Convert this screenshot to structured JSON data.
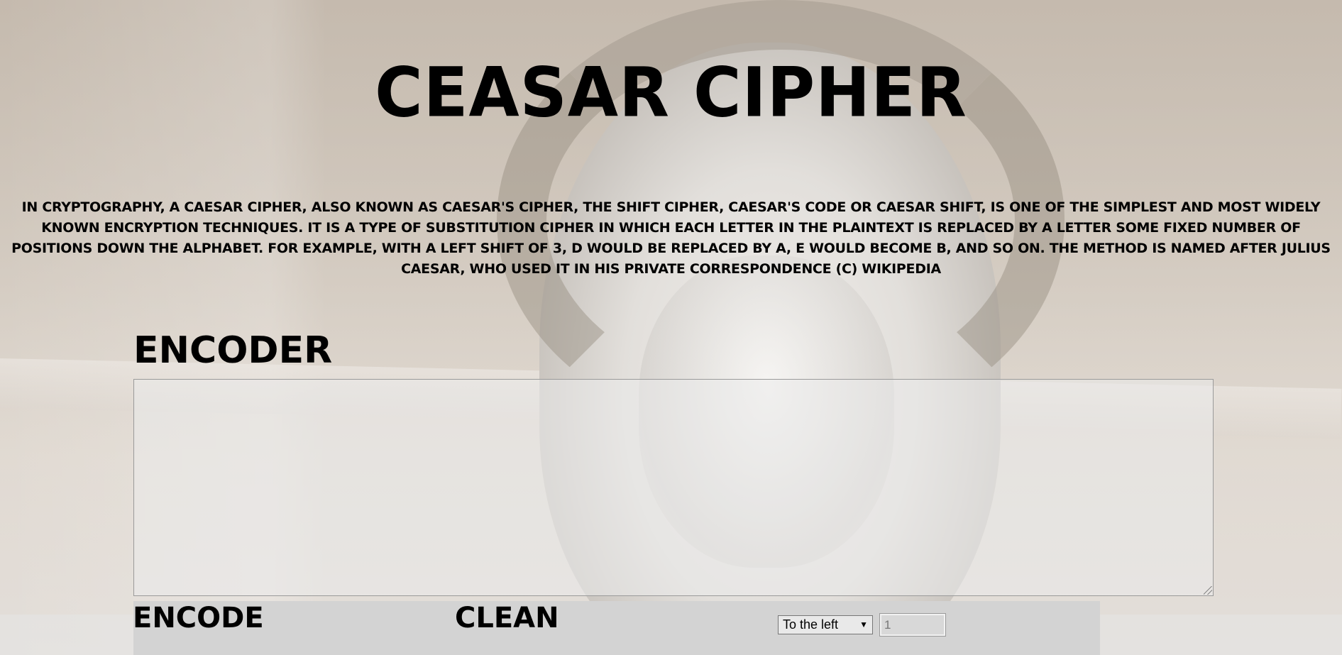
{
  "page": {
    "title": "CEASAR CIPHER",
    "intro": "In cryptography, a Caesar cipher, also known as Caesar's cipher, the shift cipher, Caesar's code or Caesar shift, is one of the simplest and most widely known encryption techniques. It is a type of substitution cipher in which each letter in the plaintext is replaced by a letter some fixed number of positions down the alphabet. For example, with a left shift of 3, D would be replaced by A, E would become B, and so on. The method is named after Julius Caesar, who used it in his private correspondence (c) Wikipedia"
  },
  "encoder": {
    "label": "ENCODER",
    "text_value": "",
    "encode_label": "ENCODE",
    "clean_label": "CLEAN",
    "direction": {
      "selected": "To the left",
      "arrow": "▼"
    },
    "shift_value": "1"
  },
  "icons": {
    "background": "caesar-statue-background",
    "resize": "resize-grip-icon",
    "dropdown": "chevron-down-icon"
  }
}
